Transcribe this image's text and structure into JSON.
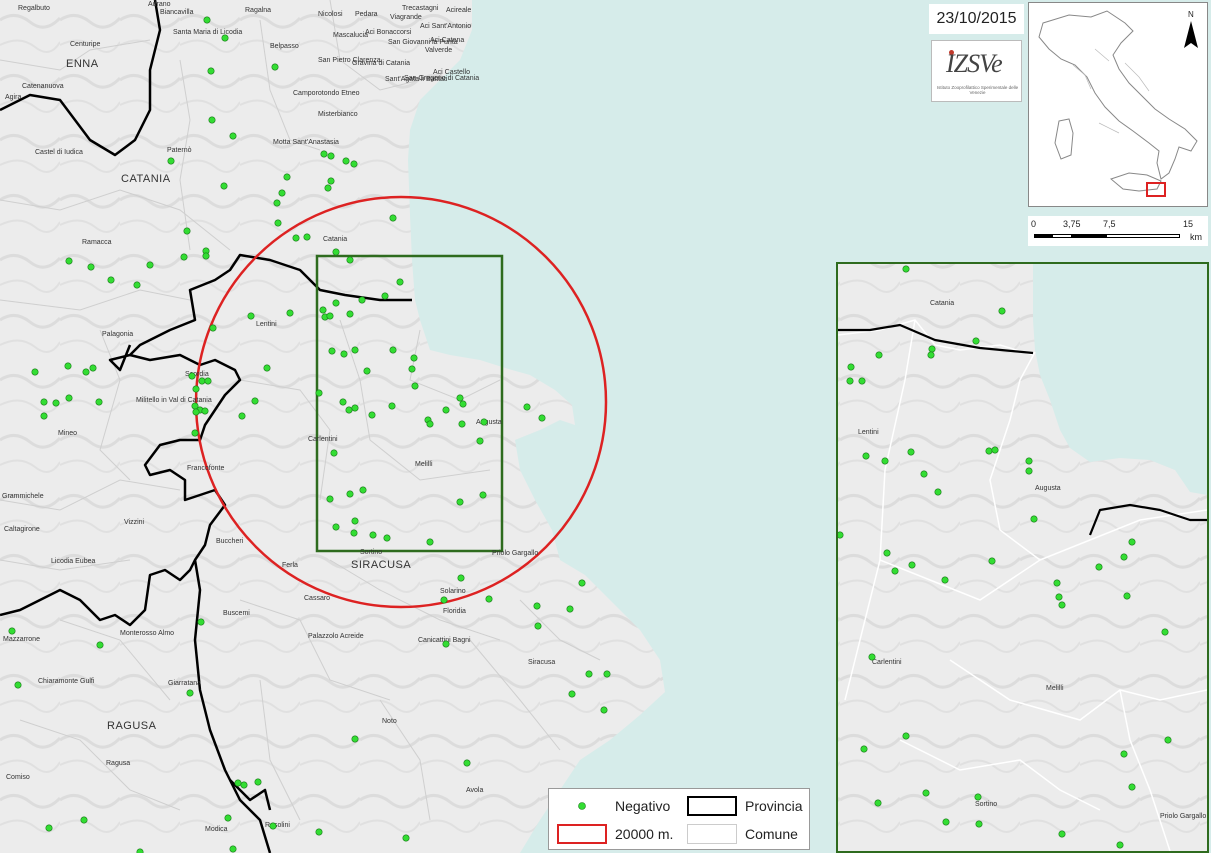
{
  "date": "23/10/2015",
  "logo": {
    "text": "IZSVe",
    "subtitle": "Istituto Zooprofilattico Sperimentale delle Venezie"
  },
  "overview": {
    "north_label": "N"
  },
  "scale": {
    "labels": [
      "0",
      "3,75",
      "7,5",
      "15"
    ],
    "unit": "km"
  },
  "provinces": [
    "ENNA",
    "CATANIA",
    "SIRACUSA",
    "RAGUSA"
  ],
  "places": [
    "Regalbuto",
    "Adrano",
    "Biancavilla",
    "Ragalna",
    "Nicolosi",
    "Pedara",
    "Trecastagni",
    "Viagrande",
    "Aci Sant'Antonio",
    "Acireale",
    "Centuripe",
    "Santa Maria di Licodia",
    "Belpasso",
    "Mascalucia",
    "Aci Bonaccorsi",
    "San Giovanni la Punta",
    "Aci Catena",
    "Valverde",
    "Catenanuova",
    "Agira",
    "San Pietro Clarenza",
    "Gravina di Catania",
    "Sant'Agata li Battiati",
    "San Gregorio di Catania",
    "Aci Castello",
    "Camporotondo Etneo",
    "Misterbianco",
    "Motta Sant'Anastasia",
    "Castel di Iudica",
    "Paternò",
    "Catania",
    "Ramacca",
    "Lentini",
    "Palagonia",
    "Scordia",
    "Militello in Val di Catania",
    "Mineo",
    "Carlentini",
    "Melilli",
    "Augusta",
    "Francofonte",
    "Grammichele",
    "Caltagirone",
    "Vizzini",
    "Licodia Eubea",
    "Buccheri",
    "Ferla",
    "Sortino",
    "Priolo Gargallo",
    "Cassaro",
    "Solarino",
    "Floridia",
    "Buscemi",
    "Mazzarrone",
    "Monterosso Almo",
    "Palazzolo Acreide",
    "Canicattini Bagni",
    "Siracusa",
    "Chiaramonte Gulfi",
    "Giarratana",
    "Noto",
    "Comiso",
    "Avola",
    "Modica",
    "Rosolini",
    "Ragusa"
  ],
  "inset_places": [
    "Catania",
    "Lentini",
    "Augusta",
    "Carlentini",
    "Melilli",
    "Sortino",
    "Priolo Gargallo"
  ],
  "legend": {
    "negative_label": "Negativo",
    "provincia_label": "Provincia",
    "radius_label": "20000 m.",
    "comune_label": "Comune"
  },
  "colors": {
    "sea": "#d6ecea",
    "land": "#ededed",
    "point": "#33dd33",
    "circle": "#dd2222",
    "inset_border": "#2e6b1e",
    "province_border": "#000000",
    "comune_border": "#ffffff"
  },
  "points": [
    [
      207,
      20
    ],
    [
      225,
      38
    ],
    [
      211,
      71
    ],
    [
      275,
      67
    ],
    [
      212,
      120
    ],
    [
      233,
      136
    ],
    [
      171,
      161
    ],
    [
      224,
      186
    ],
    [
      187,
      231
    ],
    [
      206,
      251
    ],
    [
      206,
      256
    ],
    [
      184,
      257
    ],
    [
      150,
      265
    ],
    [
      91,
      267
    ],
    [
      69,
      261
    ],
    [
      111,
      280
    ],
    [
      137,
      285
    ],
    [
      324,
      154
    ],
    [
      331,
      156
    ],
    [
      346,
      161
    ],
    [
      354,
      164
    ],
    [
      331,
      181
    ],
    [
      328,
      188
    ],
    [
      287,
      177
    ],
    [
      282,
      193
    ],
    [
      277,
      203
    ],
    [
      278,
      223
    ],
    [
      296,
      238
    ],
    [
      307,
      237
    ],
    [
      336,
      252
    ],
    [
      350,
      260
    ],
    [
      393,
      218
    ],
    [
      400,
      282
    ],
    [
      385,
      296
    ],
    [
      362,
      300
    ],
    [
      336,
      303
    ],
    [
      323,
      310
    ],
    [
      325,
      317
    ],
    [
      330,
      316
    ],
    [
      350,
      314
    ],
    [
      332,
      351
    ],
    [
      344,
      354
    ],
    [
      355,
      350
    ],
    [
      367,
      371
    ],
    [
      393,
      350
    ],
    [
      414,
      358
    ],
    [
      415,
      386
    ],
    [
      392,
      406
    ],
    [
      412,
      369
    ],
    [
      343,
      402
    ],
    [
      349,
      410
    ],
    [
      355,
      408
    ],
    [
      372,
      415
    ],
    [
      319,
      393
    ],
    [
      428,
      420
    ],
    [
      430,
      424
    ],
    [
      446,
      410
    ],
    [
      460,
      398
    ],
    [
      463,
      404
    ],
    [
      462,
      424
    ],
    [
      484,
      422
    ],
    [
      480,
      441
    ],
    [
      527,
      407
    ],
    [
      542,
      418
    ],
    [
      334,
      453
    ],
    [
      330,
      499
    ],
    [
      350,
      494
    ],
    [
      363,
      490
    ],
    [
      460,
      502
    ],
    [
      483,
      495
    ],
    [
      336,
      527
    ],
    [
      355,
      521
    ],
    [
      354,
      533
    ],
    [
      373,
      535
    ],
    [
      387,
      538
    ],
    [
      430,
      542
    ],
    [
      461,
      578
    ],
    [
      444,
      600
    ],
    [
      489,
      599
    ],
    [
      537,
      606
    ],
    [
      570,
      609
    ],
    [
      538,
      626
    ],
    [
      446,
      644
    ],
    [
      582,
      583
    ],
    [
      589,
      674
    ],
    [
      607,
      674
    ],
    [
      572,
      694
    ],
    [
      604,
      710
    ],
    [
      355,
      739
    ],
    [
      467,
      763
    ],
    [
      319,
      832
    ],
    [
      406,
      838
    ],
    [
      251,
      316
    ],
    [
      290,
      313
    ],
    [
      213,
      328
    ],
    [
      267,
      368
    ],
    [
      192,
      376
    ],
    [
      202,
      381
    ],
    [
      208,
      381
    ],
    [
      196,
      389
    ],
    [
      242,
      416
    ],
    [
      255,
      401
    ],
    [
      195,
      406
    ],
    [
      200,
      410
    ],
    [
      205,
      411
    ],
    [
      195,
      433
    ],
    [
      35,
      372
    ],
    [
      68,
      366
    ],
    [
      86,
      372
    ],
    [
      99,
      402
    ],
    [
      56,
      403
    ],
    [
      69,
      398
    ],
    [
      44,
      402
    ],
    [
      44,
      416
    ],
    [
      93,
      368
    ],
    [
      12,
      631
    ],
    [
      100,
      645
    ],
    [
      18,
      685
    ],
    [
      201,
      622
    ],
    [
      190,
      693
    ],
    [
      238,
      783
    ],
    [
      244,
      785
    ],
    [
      258,
      782
    ],
    [
      228,
      818
    ],
    [
      273,
      826
    ],
    [
      49,
      828
    ],
    [
      84,
      820
    ],
    [
      233,
      849
    ],
    [
      140,
      852
    ],
    [
      196,
      412
    ]
  ],
  "inset_points": [
    [
      906,
      269
    ],
    [
      1002,
      311
    ],
    [
      851,
      367
    ],
    [
      879,
      355
    ],
    [
      850,
      381
    ],
    [
      862,
      381
    ],
    [
      932,
      349
    ],
    [
      931,
      355
    ],
    [
      976,
      341
    ],
    [
      866,
      456
    ],
    [
      885,
      461
    ],
    [
      911,
      452
    ],
    [
      924,
      474
    ],
    [
      938,
      492
    ],
    [
      989,
      451
    ],
    [
      995,
      450
    ],
    [
      1029,
      461
    ],
    [
      1029,
      471
    ],
    [
      1034,
      519
    ],
    [
      840,
      535
    ],
    [
      887,
      553
    ],
    [
      895,
      571
    ],
    [
      912,
      565
    ],
    [
      945,
      580
    ],
    [
      992,
      561
    ],
    [
      1057,
      583
    ],
    [
      1059,
      597
    ],
    [
      1062,
      605
    ],
    [
      1099,
      567
    ],
    [
      1124,
      557
    ],
    [
      1132,
      542
    ],
    [
      1127,
      596
    ],
    [
      1165,
      632
    ],
    [
      872,
      657
    ],
    [
      864,
      749
    ],
    [
      906,
      736
    ],
    [
      1124,
      754
    ],
    [
      1168,
      740
    ],
    [
      878,
      803
    ],
    [
      926,
      793
    ],
    [
      946,
      822
    ],
    [
      978,
      797
    ],
    [
      979,
      824
    ],
    [
      1062,
      834
    ],
    [
      1132,
      787
    ],
    [
      1120,
      845
    ]
  ]
}
